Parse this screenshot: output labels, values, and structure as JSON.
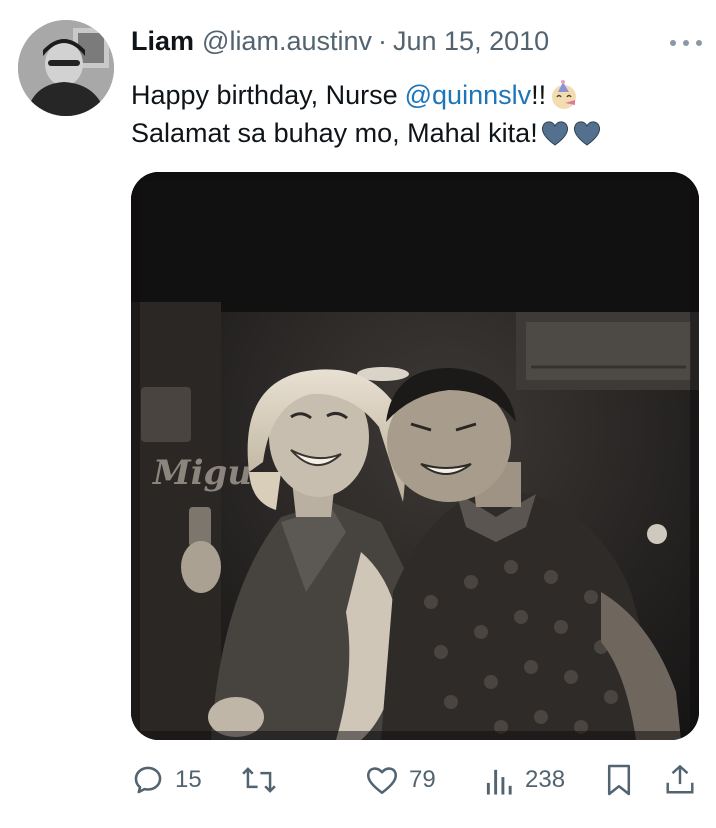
{
  "tweet": {
    "author_name": "Liam",
    "author_handle": "@liam.austinv",
    "separator": "·",
    "date": "Jun 15, 2010",
    "line1_text": "Happy birthday, Nurse",
    "mention": "@quinnslv",
    "line1_after": "!!",
    "line2_text": "Salamat sa buhay mo, Mahal kita!",
    "emojis": [
      "partying-face",
      "blue-heart",
      "blue-heart"
    ],
    "media_sign_text": "Migu"
  },
  "actions": {
    "replies": "15",
    "retweets": "",
    "likes": "79",
    "views": "238"
  },
  "colors": {
    "text": "#0f1419",
    "secondary": "#536471",
    "mention": "#1d76b9",
    "heart_emoji": "#4f6f8f"
  },
  "icons": [
    "more-icon",
    "reply-icon",
    "retweet-icon",
    "like-icon",
    "views-icon",
    "bookmark-icon",
    "share-icon"
  ]
}
